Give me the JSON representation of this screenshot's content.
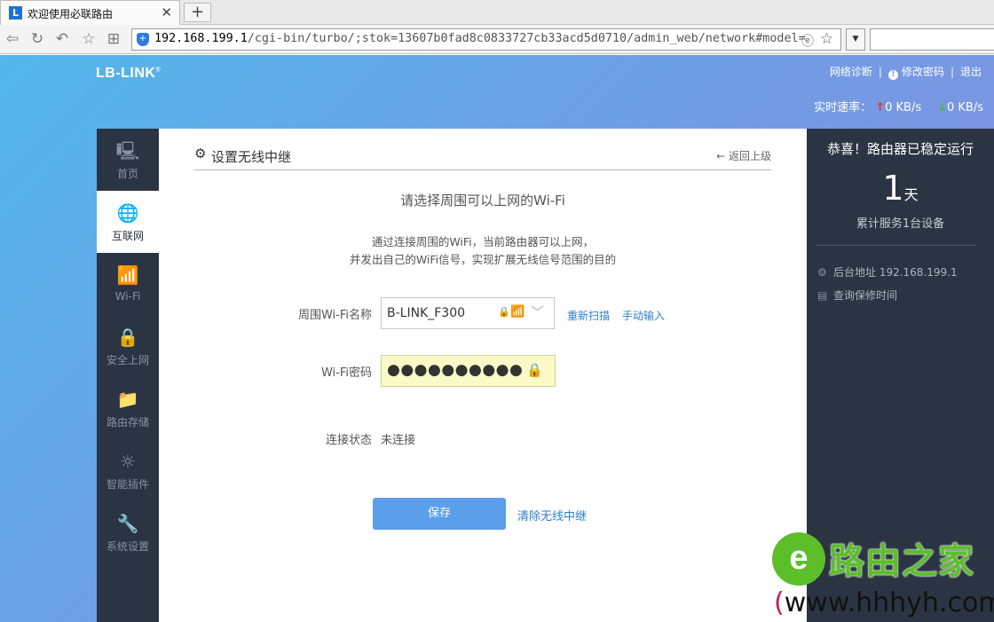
{
  "browser": {
    "tab_title": "欢迎使用必联路由",
    "tab_close": "✕",
    "new_tab": "+",
    "url_host": "192.168.199.1",
    "url_path": "/cgi-bin/turbo/;stok=13607b0fad8c0833727cb33acd5d0710/admin_web/network#model="
  },
  "header": {
    "logo": "LB-LINK",
    "logo_mark": "®",
    "links": {
      "diagnose": "网络诊断",
      "change_password": "修改密码",
      "logout": "退出"
    },
    "speed": {
      "label": "实时速率：",
      "up_arrow": "↑",
      "up": "0 KB/s",
      "down_arrow": "↓",
      "down": "0 KB/s"
    }
  },
  "sidebar": {
    "items": [
      {
        "label": "首页",
        "icon": "monitor-icon",
        "glyph": "🖳"
      },
      {
        "label": "互联网",
        "icon": "globe-icon",
        "glyph": "🌐"
      },
      {
        "label": "Wi-Fi",
        "icon": "wifi-icon",
        "glyph": "📶"
      },
      {
        "label": "安全上网",
        "icon": "lock-icon",
        "glyph": "🔒"
      },
      {
        "label": "路由存储",
        "icon": "folder-icon",
        "glyph": "📁"
      },
      {
        "label": "智能插件",
        "icon": "bulb-icon",
        "glyph": "☼"
      },
      {
        "label": "系统设置",
        "icon": "wrench-icon",
        "glyph": "🔧"
      }
    ],
    "active_index": 1
  },
  "main": {
    "title": "设置无线中继",
    "back": "← 返回上级",
    "subtitle": "请选择周围可以上网的Wi-Fi",
    "desc_line1": "通过连接周围的WiFi，当前路由器可以上网，",
    "desc_line2": "并发出自己的WiFi信号，实现扩展无线信号范围的目的",
    "ssid_label": "周围Wi-Fi名称",
    "ssid_value": "B-LINK_F300",
    "rescan": "重新扫描",
    "manual": "手动输入",
    "password_label": "Wi-Fi密码",
    "password_mask": "●●●●●●●●●●",
    "status_label": "连接状态",
    "status_value": "未连接",
    "save": "保存",
    "clear": "清除无线中继"
  },
  "info": {
    "congrats": "恭喜！路由器已稳定运行",
    "days": "1",
    "days_unit": "天",
    "served": "累计服务1台设备",
    "admin_address": "后台地址 192.168.199.1",
    "warranty": "查询保修时间"
  },
  "watermark": {
    "logo_letter": "e",
    "title": "路由之家",
    "url_prefix": "(",
    "url": "www.hhhyh.com",
    "url_suffix": ")"
  },
  "colors": {
    "sidebar_bg": "#2b3443",
    "accent_blue": "#5b9ee9",
    "link_blue": "#2d7fd0",
    "password_bg": "#fafac8",
    "watermark_green": "#5cbf2a"
  }
}
